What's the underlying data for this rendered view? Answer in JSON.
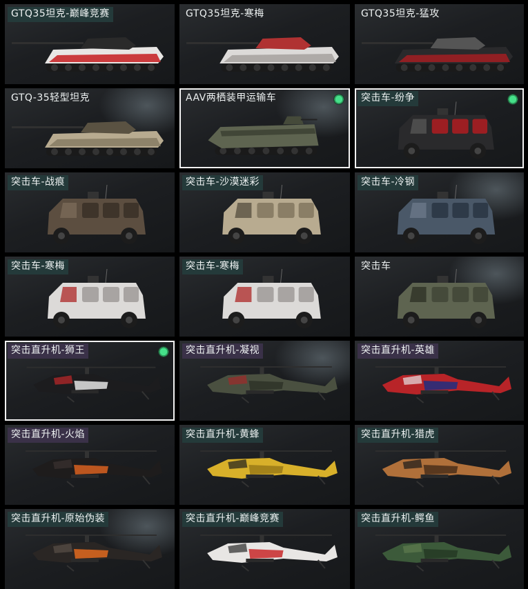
{
  "colors": {
    "tier_teal": "#243a3a",
    "tier_purple": "#3a3148",
    "selected_border": "#f2f2f2",
    "equipped_dot": "#46e08a"
  },
  "vehicles": [
    {
      "label": "GTQ35坦克-巅峰竞赛",
      "kind": "tank",
      "tier": "teal",
      "selected": false,
      "equipped": false,
      "skin": "racing-red-white"
    },
    {
      "label": "GTQ35坦克-寒梅",
      "kind": "tank",
      "tier": "none",
      "selected": false,
      "equipped": false,
      "skin": "white-plum"
    },
    {
      "label": "GTQ35坦克-猛攻",
      "kind": "tank",
      "tier": "none",
      "selected": false,
      "equipped": false,
      "skin": "black-red"
    },
    {
      "label": "GTQ-35轻型坦克",
      "kind": "tank",
      "tier": "none",
      "selected": false,
      "equipped": false,
      "skin": "desert-camo"
    },
    {
      "label": "AAV两栖装甲运输车",
      "kind": "aav",
      "tier": "none",
      "selected": true,
      "equipped": true,
      "skin": "olive"
    },
    {
      "label": "突击车-纷争",
      "kind": "assault",
      "tier": "teal",
      "selected": true,
      "equipped": true,
      "skin": "black-red"
    },
    {
      "label": "突击车-战痕",
      "kind": "assault",
      "tier": "teal",
      "selected": false,
      "equipped": false,
      "skin": "brown-worn"
    },
    {
      "label": "突击车-沙漠迷彩",
      "kind": "assault",
      "tier": "teal",
      "selected": false,
      "equipped": false,
      "skin": "desert-camo"
    },
    {
      "label": "突击车-冷钢",
      "kind": "assault",
      "tier": "teal",
      "selected": false,
      "equipped": false,
      "skin": "steel-blue"
    },
    {
      "label": "突击车-寒梅",
      "kind": "assault",
      "tier": "teal",
      "selected": false,
      "equipped": false,
      "skin": "white-plum"
    },
    {
      "label": "突击车-寒梅",
      "kind": "assault",
      "tier": "teal",
      "selected": false,
      "equipped": false,
      "skin": "white-plum"
    },
    {
      "label": "突击车",
      "kind": "assault",
      "tier": "none",
      "selected": false,
      "equipped": false,
      "skin": "olive"
    },
    {
      "label": "突击直升机-狮王",
      "kind": "heli",
      "tier": "purple",
      "selected": true,
      "equipped": true,
      "skin": "black-white-red"
    },
    {
      "label": "突击直升机-凝视",
      "kind": "heli",
      "tier": "purple",
      "selected": false,
      "equipped": false,
      "skin": "olive-red"
    },
    {
      "label": "突击直升机-英雄",
      "kind": "heli",
      "tier": "purple",
      "selected": false,
      "equipped": false,
      "skin": "red-blue"
    },
    {
      "label": "突击直升机-火焰",
      "kind": "heli",
      "tier": "purple",
      "selected": false,
      "equipped": false,
      "skin": "black-orange"
    },
    {
      "label": "突击直升机-黄蜂",
      "kind": "heli",
      "tier": "teal",
      "selected": false,
      "equipped": false,
      "skin": "yellow-black"
    },
    {
      "label": "突击直升机-猎虎",
      "kind": "heli",
      "tier": "teal",
      "selected": false,
      "equipped": false,
      "skin": "tiger-stripe"
    },
    {
      "label": "突击直升机-原始伪装",
      "kind": "heli",
      "tier": "teal",
      "selected": false,
      "equipped": false,
      "skin": "black-orange-camo"
    },
    {
      "label": "突击直升机-巅峰竞赛",
      "kind": "heli",
      "tier": "teal",
      "selected": false,
      "equipped": false,
      "skin": "racing-red-white"
    },
    {
      "label": "突击直升机-鳄鱼",
      "kind": "heli",
      "tier": "teal",
      "selected": false,
      "equipped": false,
      "skin": "green-camo"
    }
  ]
}
